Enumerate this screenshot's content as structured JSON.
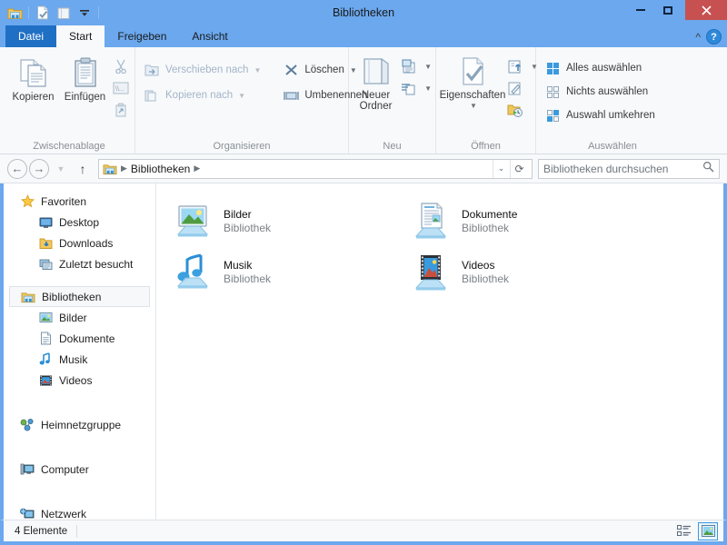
{
  "window": {
    "title": "Bibliotheken",
    "accent_color": "#6ba8ee",
    "close_color": "#c75050",
    "quick_access": [
      {
        "name": "libraries-icon",
        "label": "Bibliotheken"
      },
      {
        "name": "properties-icon",
        "label": "Eigenschaften"
      },
      {
        "name": "new-folder-icon",
        "label": "Neuer Ordner"
      },
      {
        "name": "customize-dropdown-icon",
        "label": "Symbolleiste für den Schnellzugriff anpassen"
      }
    ],
    "controls": {
      "minimize": "Minimieren",
      "maximize": "Maximieren",
      "close": "Schließen"
    }
  },
  "tabs": [
    {
      "label": "Datei",
      "state": "file"
    },
    {
      "label": "Start",
      "state": "active"
    },
    {
      "label": "Freigeben",
      "state": "normal"
    },
    {
      "label": "Ansicht",
      "state": "normal"
    }
  ],
  "ribbon": {
    "collapse_label": "Menüband minimieren",
    "help_label": "?",
    "groups": [
      {
        "label": "Zwischenablage",
        "big_buttons": [
          {
            "label": "Kopieren",
            "icon": "copy-icon",
            "disabled": false
          },
          {
            "label": "Einfügen",
            "icon": "paste-icon",
            "disabled": false
          }
        ],
        "small_buttons": [
          {
            "label": "Ausschneiden",
            "icon": "cut-icon",
            "disabled": true
          },
          {
            "label": "Pfad kopieren",
            "icon": "copy-path-icon",
            "disabled": true
          },
          {
            "label": "Verknüpfung einfügen",
            "icon": "paste-shortcut-icon",
            "disabled": true
          }
        ]
      },
      {
        "label": "Organisieren",
        "items": [
          {
            "label": "Verschieben nach",
            "icon": "move-to-icon",
            "disabled": true,
            "caret": true
          },
          {
            "label": "Kopieren nach",
            "icon": "copy-to-icon",
            "disabled": true,
            "caret": true
          },
          {
            "label": "Löschen",
            "icon": "delete-icon",
            "disabled": false,
            "caret": true
          },
          {
            "label": "Umbenennen",
            "icon": "rename-icon",
            "disabled": false,
            "caret": false
          }
        ]
      },
      {
        "label": "Neu",
        "big_buttons": [
          {
            "label": "Neuer\nOrdner",
            "label_line1": "Neuer",
            "label_line2": "Ordner",
            "icon": "new-folder-icon",
            "disabled": false
          }
        ],
        "small_buttons": [
          {
            "label": "Neues Element",
            "icon": "new-item-icon",
            "disabled": false,
            "caret": true
          },
          {
            "label": "Einfacher Zugriff",
            "icon": "easy-access-icon",
            "disabled": false,
            "caret": true
          }
        ]
      },
      {
        "label": "Öffnen",
        "big_buttons": [
          {
            "label": "Eigenschaften",
            "icon": "properties-icon",
            "disabled": false,
            "caret": true
          }
        ],
        "small_buttons": [
          {
            "label": "Öffnen",
            "icon": "open-icon",
            "disabled": false,
            "caret": true
          },
          {
            "label": "Bearbeiten",
            "icon": "edit-icon",
            "disabled": false,
            "caret": false
          },
          {
            "label": "Verlauf",
            "icon": "history-icon",
            "disabled": false,
            "caret": false
          }
        ]
      },
      {
        "label": "Auswählen",
        "items": [
          {
            "label": "Alles auswählen",
            "icon": "select-all-icon"
          },
          {
            "label": "Nichts auswählen",
            "icon": "select-none-icon"
          },
          {
            "label": "Auswahl umkehren",
            "icon": "invert-selection-icon"
          }
        ]
      }
    ]
  },
  "addressbar": {
    "back_label": "Zurück",
    "forward_label": "Vorwärts",
    "history_label": "Zuletzt besuchte Seiten",
    "up_label": "Eine Ebene nach oben",
    "path_icon": "libraries-icon",
    "crumb": "Bibliotheken",
    "refresh_label": "Aktualisieren",
    "search_placeholder": "Bibliotheken durchsuchen",
    "search_value": ""
  },
  "sidebar": {
    "sections": [
      {
        "header": {
          "label": "Favoriten",
          "icon": "star-icon"
        },
        "items": [
          {
            "label": "Desktop",
            "icon": "desktop-icon"
          },
          {
            "label": "Downloads",
            "icon": "downloads-icon"
          },
          {
            "label": "Zuletzt besucht",
            "icon": "recent-places-icon"
          }
        ]
      },
      {
        "header": {
          "label": "Bibliotheken",
          "icon": "libraries-icon",
          "selected": true
        },
        "items": [
          {
            "label": "Bilder",
            "icon": "pictures-icon"
          },
          {
            "label": "Dokumente",
            "icon": "documents-icon"
          },
          {
            "label": "Musik",
            "icon": "music-icon"
          },
          {
            "label": "Videos",
            "icon": "videos-icon"
          }
        ]
      },
      {
        "header": {
          "label": "Heimnetzgruppe",
          "icon": "homegroup-icon"
        },
        "items": []
      },
      {
        "header": {
          "label": "Computer",
          "icon": "computer-icon"
        },
        "items": []
      },
      {
        "header": {
          "label": "Netzwerk",
          "icon": "network-icon"
        },
        "items": []
      }
    ]
  },
  "content": {
    "items": [
      {
        "name": "Bilder",
        "subtitle": "Bibliothek",
        "icon": "pictures-library-icon"
      },
      {
        "name": "Dokumente",
        "subtitle": "Bibliothek",
        "icon": "documents-library-icon"
      },
      {
        "name": "Musik",
        "subtitle": "Bibliothek",
        "icon": "music-library-icon"
      },
      {
        "name": "Videos",
        "subtitle": "Bibliothek",
        "icon": "videos-library-icon"
      }
    ]
  },
  "statusbar": {
    "item_count": "4 Elemente",
    "views": [
      {
        "name": "details-view-button",
        "label": "Detailansicht",
        "active": false
      },
      {
        "name": "large-icons-view-button",
        "label": "Große Symbole",
        "active": true
      }
    ]
  }
}
